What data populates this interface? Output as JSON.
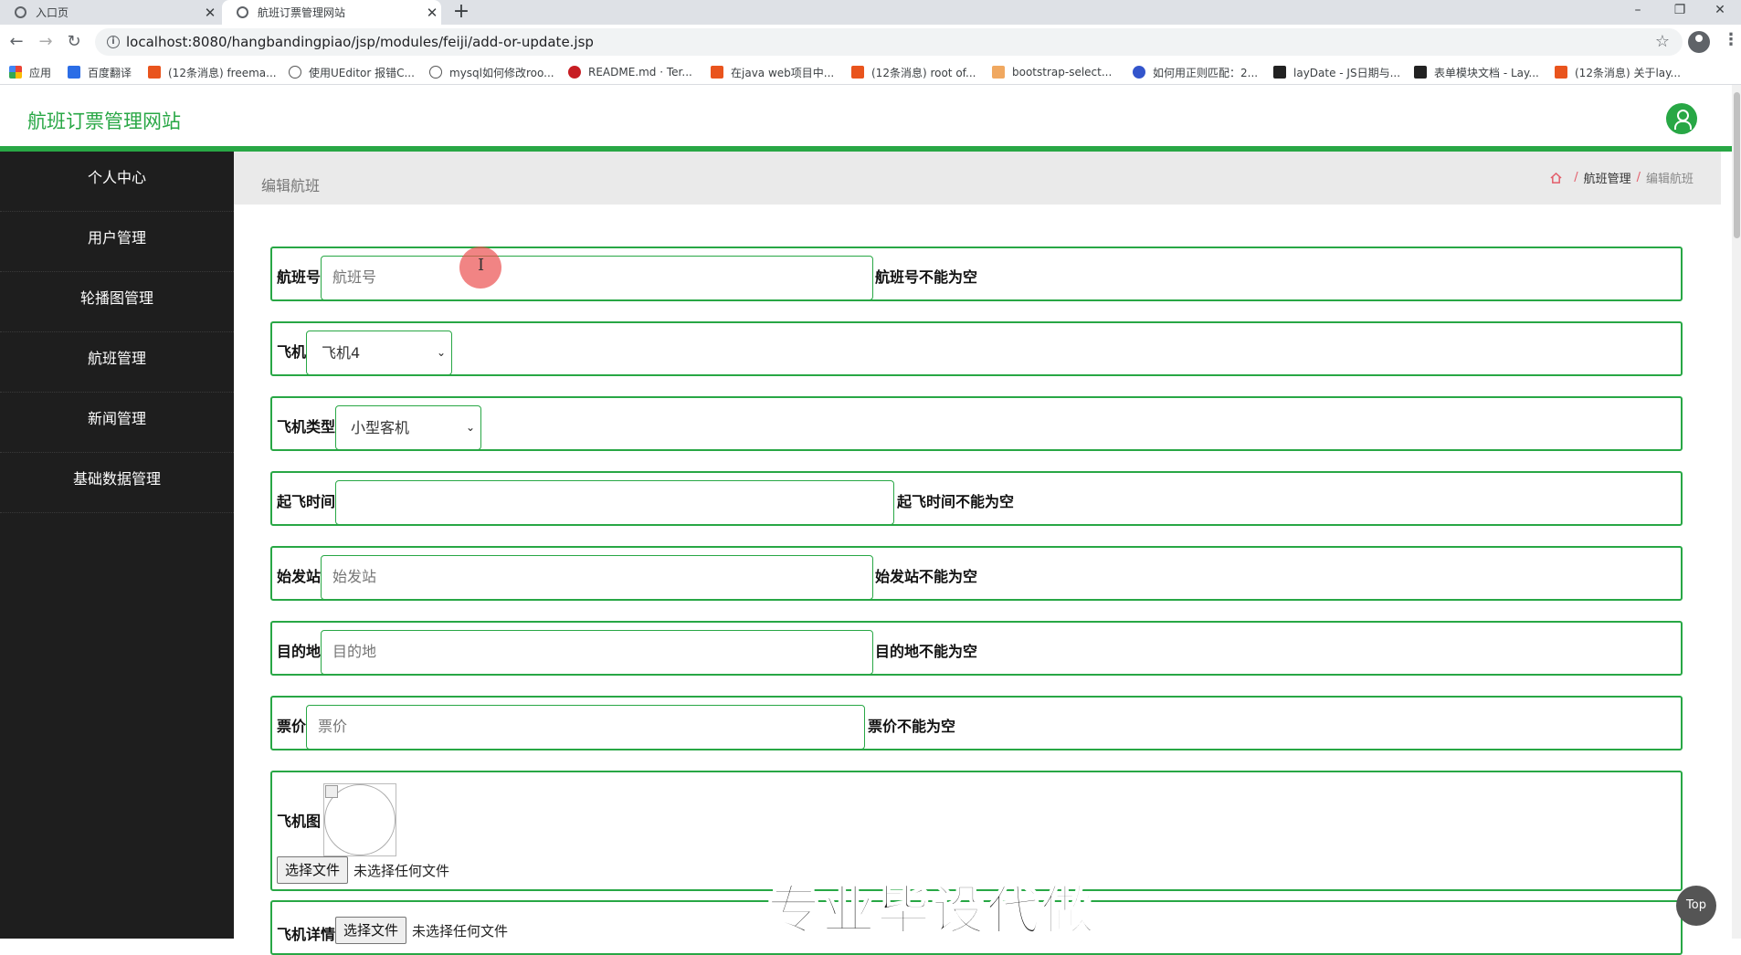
{
  "browser": {
    "tabs": [
      {
        "label": "入口页"
      },
      {
        "label": "航班订票管理网站"
      }
    ],
    "url": "localhost:8080/hangbandingpiao/jsp/modules/feiji/add-or-update.jsp",
    "bookmarks": [
      "应用",
      "百度翻译",
      "(12条消息) freema...",
      "使用UEditor 报错C...",
      "mysql如何修改roo...",
      "README.md · Ter...",
      "在java web项目中...",
      "(12条消息) root of...",
      "bootstrap-select...",
      "如何用正则匹配：2...",
      "layDate - JS日期与...",
      "表单模块文档 - Lay...",
      "(12条消息) 关于lay..."
    ]
  },
  "header": {
    "site_title": "航班订票管理网站"
  },
  "sidebar": {
    "items": [
      {
        "label": "个人中心"
      },
      {
        "label": "用户管理"
      },
      {
        "label": "轮播图管理"
      },
      {
        "label": "航班管理"
      },
      {
        "label": "新闻管理"
      },
      {
        "label": "基础数据管理"
      }
    ]
  },
  "page": {
    "title": "编辑航班",
    "breadcrumb": [
      "航班管理",
      "编辑航班"
    ]
  },
  "form": {
    "flight_no": {
      "label": "航班号",
      "placeholder": "航班号",
      "error": "航班号不能为空"
    },
    "plane": {
      "label": "飞机",
      "selected": "飞机4"
    },
    "plane_type": {
      "label": "飞机类型",
      "selected": "小型客机"
    },
    "takeoff_time": {
      "label": "起飞时间",
      "value": "",
      "error": "起飞时间不能为空"
    },
    "origin": {
      "label": "始发站",
      "placeholder": "始发站",
      "error": "始发站不能为空"
    },
    "destination": {
      "label": "目的地",
      "placeholder": "目的地",
      "error": "目的地不能为空"
    },
    "price": {
      "label": "票价",
      "placeholder": "票价",
      "error": "票价不能为空"
    },
    "plane_image": {
      "label": "飞机图",
      "button": "选择文件",
      "status": "未选择任何文件"
    },
    "plane_detail": {
      "label": "飞机详情",
      "button": "选择文件",
      "status": "未选择任何文件"
    }
  },
  "overlay": {
    "watermark": "专业毕设代做",
    "top_button": "Top"
  },
  "colors": {
    "accent": "#28a745",
    "sidebar_bg": "#1e1e1e"
  }
}
